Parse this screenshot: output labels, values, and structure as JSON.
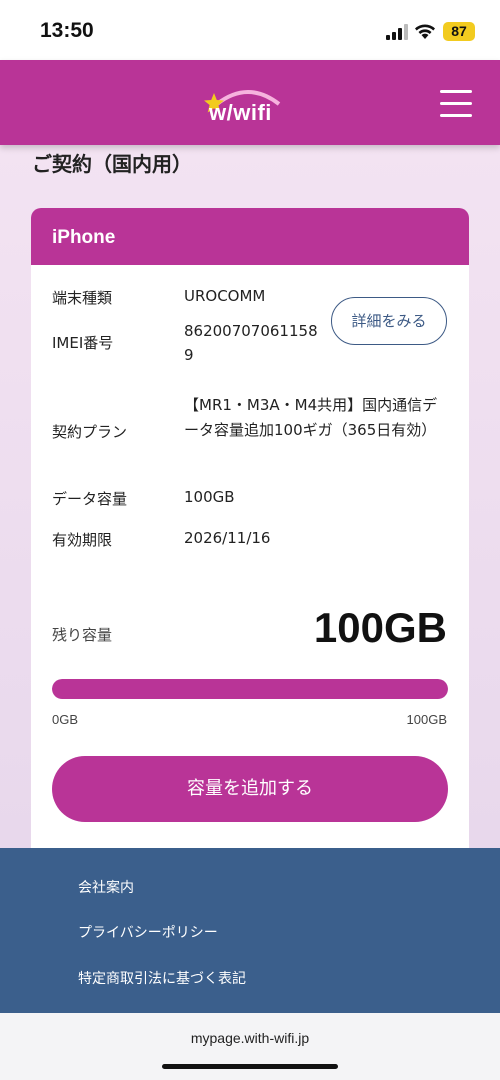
{
  "status_bar": {
    "time": "13:50",
    "battery": "87",
    "signal_icon": "cellular-signal-icon",
    "wifi_icon": "wifi-icon"
  },
  "header": {
    "logo_text": "w/wifi",
    "menu_icon": "hamburger-menu-icon",
    "color": "#b93497"
  },
  "page": {
    "title": "ご契約（国内用）"
  },
  "card": {
    "title": "iPhone",
    "rows": [
      {
        "label": "端末種類",
        "value": "UROCOMM"
      },
      {
        "label": "IMEI番号",
        "value": "862007070611589"
      },
      {
        "label": "契約プラン",
        "value": "【MR1・M3A・M4共用】国内通信データ容量追加100ギガ（365日有効）"
      },
      {
        "label": "データ容量",
        "value": "100GB"
      },
      {
        "label": "有効期限",
        "value": "2026/11/16"
      }
    ],
    "detail_button": "詳細をみる",
    "remaining_label": "残り容量",
    "remaining_value": "100GB",
    "remaining_fraction": 1.0,
    "scale_min": "0GB",
    "scale_max": "100GB",
    "add_button": "容量を追加する"
  },
  "footer": {
    "links": [
      "会社案内",
      "プライバシーポリシー",
      "特定商取引法に基づく表記"
    ],
    "color": "#3b5f8c"
  },
  "browser": {
    "url": "mypage.with-wifi.jp"
  }
}
